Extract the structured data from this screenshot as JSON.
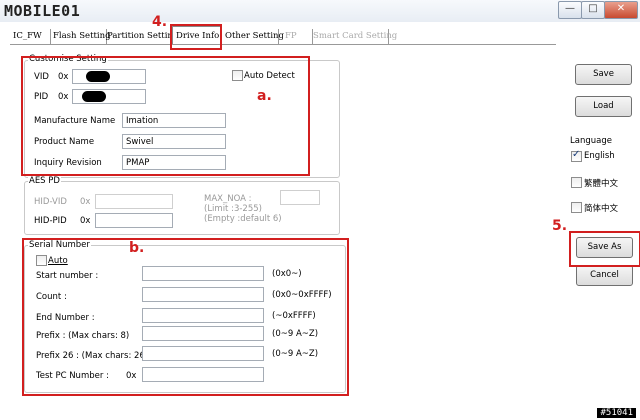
{
  "window": {
    "logo_text": "MOBILE01",
    "min_symbol": "—",
    "max_symbol": "□",
    "close_symbol": "✕"
  },
  "tabs": [
    {
      "label": "IC_FW",
      "state": "normal"
    },
    {
      "label": "Flash Setting",
      "state": "normal"
    },
    {
      "label": "Partition Setting",
      "state": "normal"
    },
    {
      "label": "Drive Info",
      "state": "active"
    },
    {
      "label": "Other Setting",
      "state": "normal"
    },
    {
      "label": "FP",
      "state": "disabled"
    },
    {
      "label": "Smart Card Setting",
      "state": "disabled"
    }
  ],
  "customise": {
    "title": "Customise Setting",
    "vid_label": "VID",
    "vid_prefix": "0x",
    "pid_label": "PID",
    "pid_prefix": "0x",
    "auto_detect_label": "Auto Detect",
    "auto_detect_checked": false,
    "manufacture_label": "Manufacture Name",
    "manufacture_value": "Imation",
    "product_label": "Product Name",
    "product_value": "Swivel",
    "inquiry_label": "Inquiry Revision",
    "inquiry_value": "PMAP"
  },
  "aes": {
    "title": "AES PD",
    "hid_vid_label": "HID-VID",
    "hid_vid_prefix": "0x",
    "hid_pid_label": "HID-PID",
    "hid_pid_prefix": "0x",
    "max_noa_label": "MAX_NOA :",
    "limit_text": "(Limit :3-255)",
    "empty_text": "(Empty :default 6)"
  },
  "serial": {
    "title": "Serial Number",
    "auto_label": "Auto",
    "auto_checked": false,
    "rows": [
      {
        "label": "Start number :",
        "hint": "(0x0~)"
      },
      {
        "label": "Count :",
        "hint": "(0x0~0xFFFF)"
      },
      {
        "label": "End Number :",
        "hint": "(~0xFFFF)"
      },
      {
        "label": "Prefix : (Max chars: 8)",
        "hint": "(0~9 A~Z)"
      },
      {
        "label": "Prefix 26 : (Max chars: 26)",
        "hint": "(0~9 A~Z)"
      }
    ],
    "test_pc_label": "Test PC Number :",
    "test_pc_prefix": "0x"
  },
  "side": {
    "save_label": "Save",
    "load_label": "Load",
    "language_title": "Language",
    "languages": [
      {
        "label": "English",
        "checked": true
      },
      {
        "label": "繁體中文",
        "checked": false
      },
      {
        "label": "简体中文",
        "checked": false
      }
    ],
    "save_as_label": "Save As",
    "cancel_label": "Cancel"
  },
  "annotations": {
    "step4": "4.",
    "step_a": "a.",
    "step_b": "b.",
    "step5": "5.",
    "accent": "#d21f1f"
  },
  "watermark": "#51041"
}
